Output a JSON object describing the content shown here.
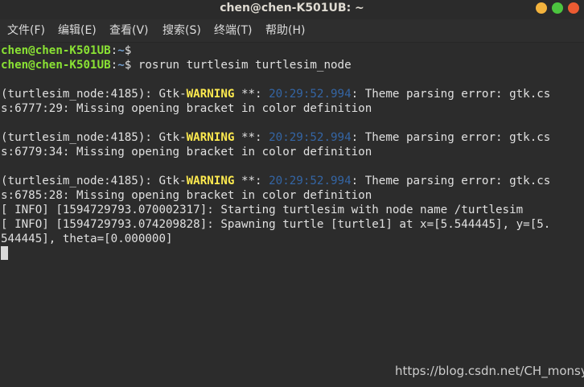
{
  "window": {
    "title": "chen@chen-K501UB: ~",
    "colors": {
      "background": "#2c2c2c",
      "minimize": "#f3b33d",
      "maximize": "#4cc53f",
      "close": "#ec5b32"
    }
  },
  "menu": {
    "file": "文件(F)",
    "edit": "编辑(E)",
    "view": "查看(V)",
    "search": "搜索(S)",
    "terminal": "终端(T)",
    "help": "帮助(H)"
  },
  "terminal": {
    "prompt": {
      "user": "chen@chen-K501UB",
      "sep": ":",
      "path": "~",
      "sign": "$"
    },
    "command": " rosrun turtlesim turtlesim_node",
    "warnings": [
      {
        "prefix": "(turtlesim_node:4185): Gtk-",
        "level": "WARNING",
        "mid": " **: ",
        "time": "20:29:52.994",
        "msg1": ": Theme parsing error: gtk.cs",
        "msg2": "s:6777:29: Missing opening bracket in color definition"
      },
      {
        "prefix": "(turtlesim_node:4185): Gtk-",
        "level": "WARNING",
        "mid": " **: ",
        "time": "20:29:52.994",
        "msg1": ": Theme parsing error: gtk.cs",
        "msg2": "s:6779:34: Missing opening bracket in color definition"
      },
      {
        "prefix": "(turtlesim_node:4185): Gtk-",
        "level": "WARNING",
        "mid": " **: ",
        "time": "20:29:52.994",
        "msg1": ": Theme parsing error: gtk.cs",
        "msg2": "s:6785:28: Missing opening bracket in color definition"
      }
    ],
    "info": [
      "[ INFO] [1594729793.070002317]: Starting turtlesim with node name /turtlesim",
      "[ INFO] [1594729793.074209828]: Spawning turtle [turtle1] at x=[5.544445], y=[5.",
      "544445], theta=[0.000000]"
    ]
  },
  "watermark": "https://blog.csdn.net/CH_monsy"
}
